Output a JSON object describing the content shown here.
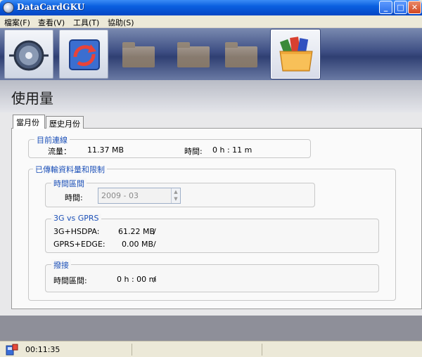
{
  "window": {
    "title": "DataCardGKU"
  },
  "menu": [
    {
      "label": "檔案(F)"
    },
    {
      "label": "查看(V)"
    },
    {
      "label": "工具(T)"
    },
    {
      "label": "協助(S)"
    }
  ],
  "toolbar": {
    "buttons": [
      {
        "icon": "disconnect-icon",
        "state": "enabled"
      },
      {
        "icon": "sync-icon",
        "state": "enabled"
      },
      {
        "icon": "contacts-folder-icon",
        "state": "disabled"
      },
      {
        "icon": "sms-folder-icon",
        "state": "disabled"
      },
      {
        "icon": "mail-folder-icon",
        "state": "disabled"
      },
      {
        "icon": "usage-folder-icon",
        "state": "selected"
      }
    ]
  },
  "page": {
    "title": "使用量"
  },
  "tabs": [
    {
      "label": "當月份",
      "active": true
    },
    {
      "label": "歷史月份",
      "active": false
    }
  ],
  "current_connection": {
    "legend": "目前連線",
    "traffic_label": "流量：",
    "traffic_value": "11.37 MB",
    "time_label": "時間:",
    "time_value": "0 h : 11 m"
  },
  "transfer_limit": {
    "legend": "已傳輸資料量和限制",
    "period_group": {
      "legend": "時間區間",
      "time_label": "時間:",
      "period_value": "2009 - 03"
    },
    "network_group": {
      "legend": "3G vs GPRS",
      "rows": [
        {
          "label": "3G+HSDPA:",
          "value": "61.22 MB",
          "suffix": "/"
        },
        {
          "label": "GPRS+EDGE:",
          "value": "0.00 MB",
          "suffix": "/"
        }
      ]
    },
    "dialup_group": {
      "legend": "撥接",
      "time_label": "時間區間:",
      "time_value": "0 h : 00 m",
      "suffix": "/"
    }
  },
  "status": {
    "elapsed": "00:11:35"
  }
}
